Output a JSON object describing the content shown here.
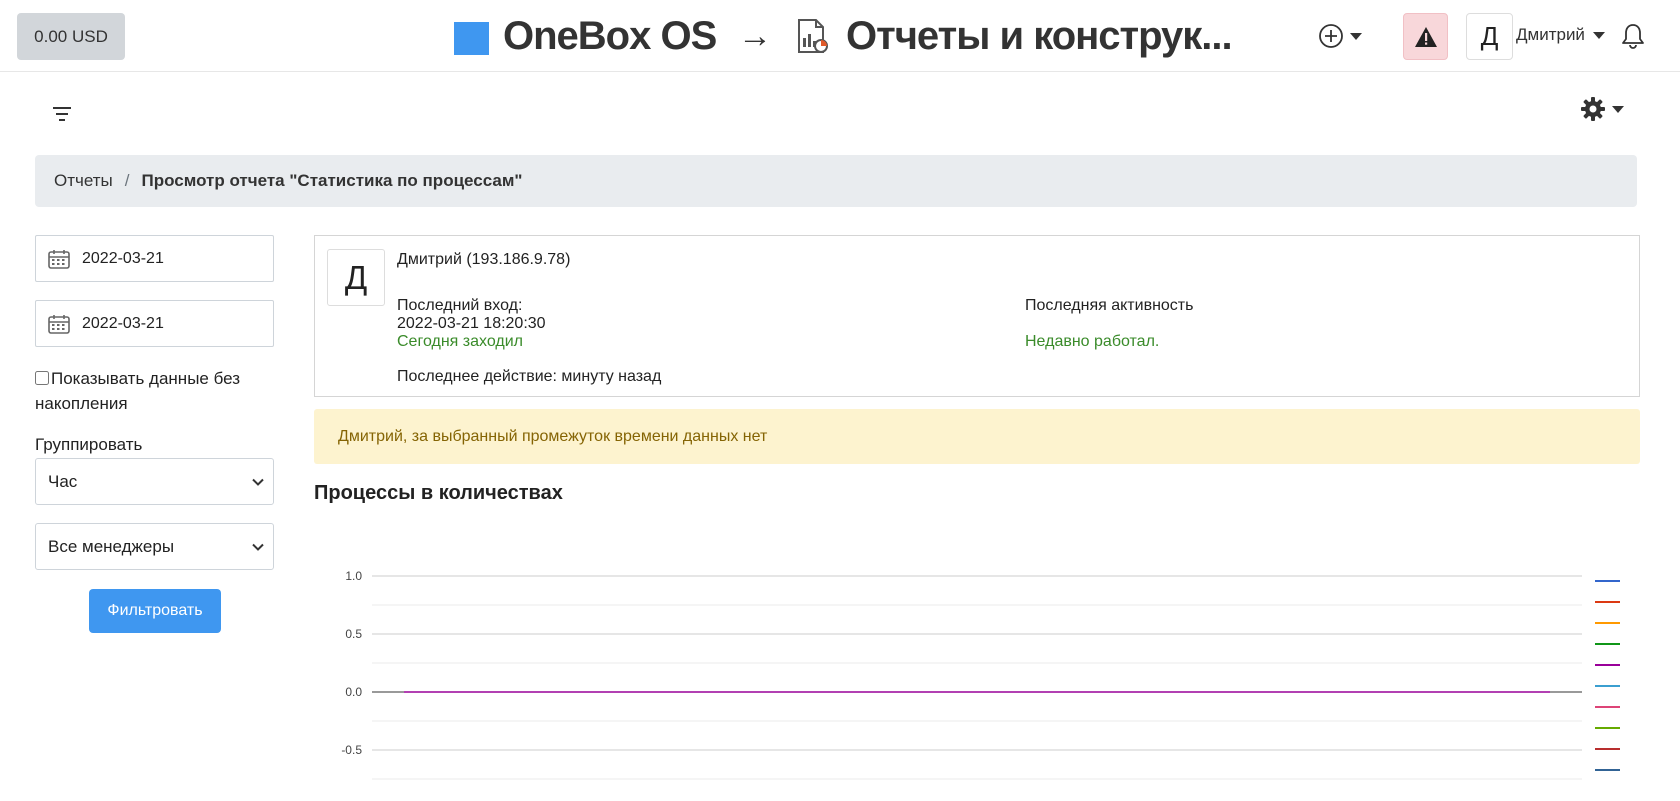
{
  "header": {
    "balance": "0.00 USD",
    "brand_name": "OneBox OS",
    "arrow": "→",
    "section_title": "Отчеты и конструк...",
    "alert_icon": "warning-triangle-icon",
    "user_initial": "Д",
    "user_name": "Дмитрий"
  },
  "breadcrumb": {
    "root": "Отчеты",
    "separator": "/",
    "current": "Просмотр отчета \"Статистика по процессам\""
  },
  "filters": {
    "date_from": "2022-03-21",
    "date_to": "2022-03-21",
    "no_accumulation_label": "Показывать данные без накопления",
    "no_accumulation_checked": false,
    "group_label": "Группировать",
    "group_value": "Час",
    "managers_value": "Все менеджеры",
    "submit_label": "Фильтровать"
  },
  "user_card": {
    "initial": "Д",
    "name_ip": "Дмитрий (193.186.9.78)",
    "last_login_label": "Последний вход:",
    "last_login_value": "2022-03-21 18:20:30",
    "last_login_status": "Сегодня заходил",
    "last_activity_label": "Последняя активность",
    "last_activity_status": "Недавно работал.",
    "last_action": "Последнее действие: минуту назад"
  },
  "warning": {
    "text": "Дмитрий, за выбранный промежуток времени данных нет"
  },
  "chart_section": {
    "title": "Процессы в количествах"
  },
  "colors": {
    "accent": "#3f97f0",
    "balance_bg": "#d2d6da",
    "alert_bg": "#f8d7da",
    "warning_bg": "#fdf3cf",
    "success_text": "#3a8b2a"
  },
  "chart_data": {
    "type": "line",
    "title": "",
    "xlabel": "",
    "ylabel": "",
    "ylim": [
      -0.5,
      1.0
    ],
    "yticks": [
      "1.0",
      "0.5",
      "0.0",
      "-0.5"
    ],
    "grid": true,
    "legend_position": "right",
    "series_colors": [
      "#3366cc",
      "#dc3912",
      "#ff9900",
      "#109618",
      "#990099",
      "#3b9fd0",
      "#dd4477",
      "#66aa00",
      "#b82e2e",
      "#316395"
    ],
    "series": [
      {
        "values": [
          0,
          0
        ]
      }
    ]
  }
}
